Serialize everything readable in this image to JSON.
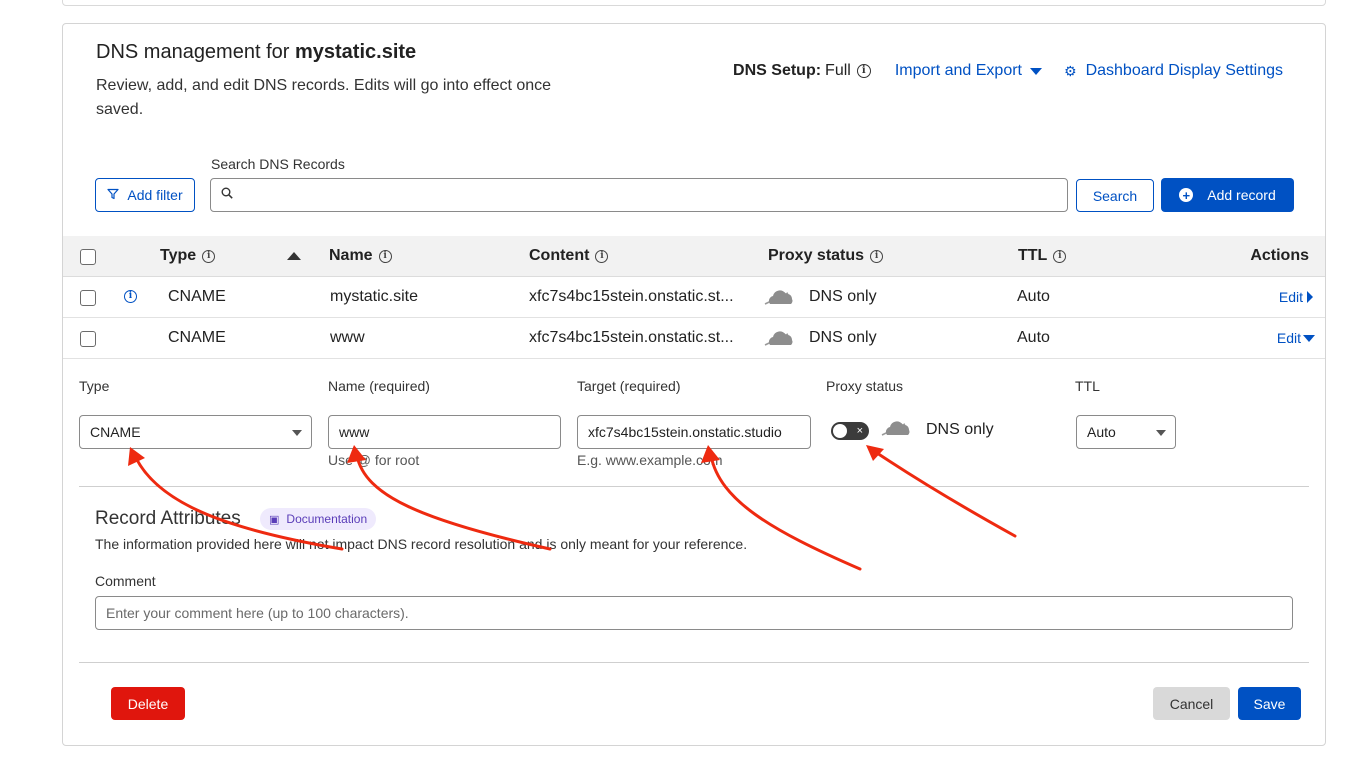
{
  "header": {
    "title_prefix": "DNS management for",
    "domain": "mystatic.site",
    "description": "Review, add, and edit DNS records. Edits will go into effect once saved.",
    "dns_setup_label": "DNS Setup:",
    "dns_setup_value": "Full",
    "import_export": "Import and Export",
    "display_settings": "Dashboard Display Settings"
  },
  "search": {
    "label": "Search DNS Records",
    "placeholder": "",
    "add_filter": "Add filter",
    "search_button": "Search",
    "add_record": "Add record"
  },
  "table": {
    "columns": {
      "type": "Type",
      "name": "Name",
      "content": "Content",
      "proxy": "Proxy status",
      "ttl": "TTL",
      "actions": "Actions"
    },
    "rows": [
      {
        "type": "CNAME",
        "name": "mystatic.site",
        "content": "xfc7s4bc15stein.onstatic.st...",
        "proxy": "DNS only",
        "ttl": "Auto",
        "action": "Edit"
      },
      {
        "type": "CNAME",
        "name": "www",
        "content": "xfc7s4bc15stein.onstatic.st...",
        "proxy": "DNS only",
        "ttl": "Auto",
        "action": "Edit"
      }
    ]
  },
  "edit_form": {
    "type_label": "Type",
    "type_value": "CNAME",
    "name_label": "Name (required)",
    "name_value": "www",
    "name_hint": "Use @ for root",
    "target_label": "Target (required)",
    "target_value": "xfc7s4bc15stein.onstatic.studio",
    "target_hint": "E.g. www.example.com",
    "proxy_label": "Proxy status",
    "proxy_value": "DNS only",
    "ttl_label": "TTL",
    "ttl_value": "Auto"
  },
  "record_attributes": {
    "title": "Record Attributes",
    "doc_badge": "Documentation",
    "description": "The information provided here will not impact DNS record resolution and is only meant for your reference.",
    "comment_label": "Comment",
    "comment_placeholder": "Enter your comment here (up to 100 characters)."
  },
  "actions": {
    "delete": "Delete",
    "cancel": "Cancel",
    "save": "Save"
  },
  "colors": {
    "accent": "#0051c3",
    "danger": "#e0160d",
    "annotation_arrow": "#ee2a10"
  }
}
